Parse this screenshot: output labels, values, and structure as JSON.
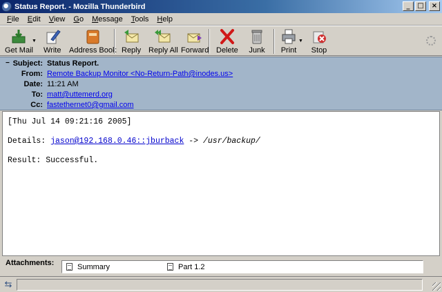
{
  "window": {
    "title": "Status Report. - Mozilla Thunderbird"
  },
  "menu": [
    "File",
    "Edit",
    "View",
    "Go",
    "Message",
    "Tools",
    "Help"
  ],
  "toolbar": {
    "get_mail": "Get Mail",
    "write": "Write",
    "address_book": "Address Book",
    "reply": "Reply",
    "reply_all": "Reply All",
    "forward": "Forward",
    "delete": "Delete",
    "junk": "Junk",
    "print": "Print",
    "stop": "Stop"
  },
  "headers": {
    "subject_label": "Subject:",
    "subject": "Status Report.",
    "from_label": "From:",
    "from": "Remote Backup Monitor <No-Return-Path@inodes.us>",
    "date_label": "Date:",
    "date": "11:21 AM",
    "to_label": "To:",
    "to": "matt@uttemerd.org",
    "cc_label": "Cc:",
    "cc": "fastethernet0@gmail.com"
  },
  "body": {
    "timestamp": "[Thu Jul 14 09:21:16 2005]",
    "details_label": "Details:",
    "details_source": "jason@192.168.0.46::jburback",
    "details_arrow": "->",
    "details_dest": "/usr/backup/",
    "result": "Result: Successful."
  },
  "attachments": {
    "label": "Attachments:",
    "items": [
      "Summary",
      "Part 1.2"
    ]
  },
  "icons": {
    "get_mail": "inbox-download-icon",
    "write": "pen-paper-icon",
    "address_book": "address-book-icon",
    "reply": "reply-envelope-icon",
    "reply_all": "reply-all-envelope-icon",
    "forward": "forward-envelope-icon",
    "delete": "delete-x-icon",
    "junk": "trash-can-icon",
    "print": "printer-icon",
    "stop": "stop-icon"
  },
  "colors": {
    "header_bg": "#a2b5c9",
    "title_bar": "#0a246a",
    "link": "#0000ee"
  }
}
